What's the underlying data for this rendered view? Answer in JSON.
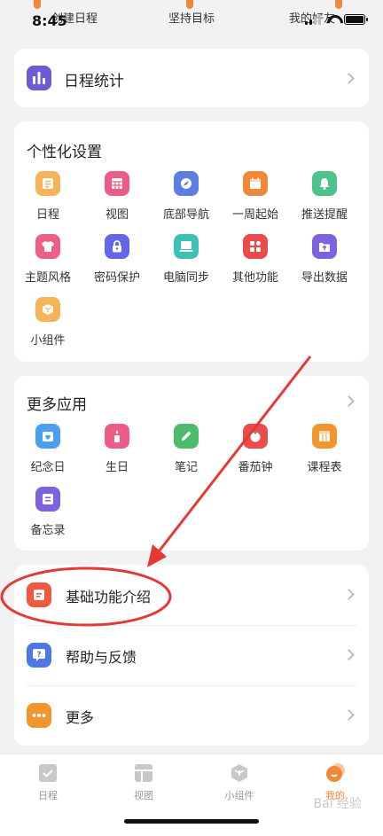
{
  "status_bar": {
    "time": "8:45"
  },
  "top_strip": [
    "创建日程",
    "坚持目标",
    "我的好友"
  ],
  "stats_row": {
    "label": "日程统计"
  },
  "personalization": {
    "title": "个性化设置",
    "items": [
      {
        "label": "日程",
        "icon": "list-icon",
        "color": "#f5b45a"
      },
      {
        "label": "视图",
        "icon": "grid-icon",
        "color": "#ea5d86"
      },
      {
        "label": "底部导航",
        "icon": "compass-icon",
        "color": "#5b7fe0"
      },
      {
        "label": "一周起始",
        "icon": "calendar-icon",
        "color": "#f0883a"
      },
      {
        "label": "推送提醒",
        "icon": "bell-icon",
        "color": "#4cc38a"
      },
      {
        "label": "主题风格",
        "icon": "shirt-icon",
        "color": "#ee5f85"
      },
      {
        "label": "密码保护",
        "icon": "lock-icon",
        "color": "#6366e8"
      },
      {
        "label": "电脑同步",
        "icon": "laptop-icon",
        "color": "#3cc2b4"
      },
      {
        "label": "其他功能",
        "icon": "apps-icon",
        "color": "#ea4c4c"
      },
      {
        "label": "导出数据",
        "icon": "export-icon",
        "color": "#7d63e0"
      },
      {
        "label": "小组件",
        "icon": "cube-icon",
        "color": "#f5b45a"
      }
    ]
  },
  "more_apps": {
    "title": "更多应用",
    "items": [
      {
        "label": "纪念日",
        "icon": "anniversary-icon",
        "color": "#4a9ff0"
      },
      {
        "label": "生日",
        "icon": "candle-icon",
        "color": "#ec5c86"
      },
      {
        "label": "笔记",
        "icon": "pencil-icon",
        "color": "#4cbb6c"
      },
      {
        "label": "番茄钟",
        "icon": "tomato-icon",
        "color": "#ea4c4c"
      },
      {
        "label": "课程表",
        "icon": "timetable-icon",
        "color": "#f0962e"
      },
      {
        "label": "备忘录",
        "icon": "memo-icon",
        "color": "#7d63e0"
      }
    ]
  },
  "info_list": [
    {
      "label": "基础功能介绍",
      "icon": "doc-icon",
      "color": "#ef5a3f"
    },
    {
      "label": "帮助与反馈",
      "icon": "help-icon",
      "color": "#4d78e6"
    },
    {
      "label": "更多",
      "icon": "more-icon",
      "color": "#f0962e"
    }
  ],
  "tabbar": [
    {
      "label": "日程",
      "icon": "check-square-icon"
    },
    {
      "label": "视图",
      "icon": "layout-icon"
    },
    {
      "label": "小组件",
      "icon": "hexagon-icon"
    },
    {
      "label": "我的",
      "icon": "profile-icon",
      "active": true
    }
  ],
  "watermark": "Bai 经验",
  "colors": {
    "accent": "#f0883a",
    "annotation": "#e53935"
  }
}
